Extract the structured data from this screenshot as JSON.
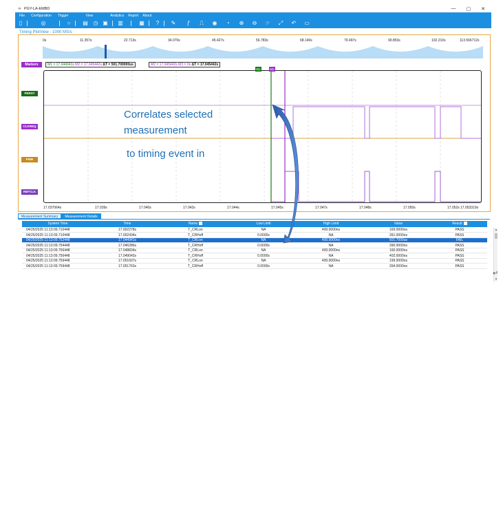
{
  "app": {
    "title": "PGY-LA-EMBD",
    "window_controls": [
      "—",
      "▢",
      "✕"
    ]
  },
  "menu": [
    "File",
    "Configuration",
    "Trigger",
    "View",
    "Analytics",
    "Report",
    "About"
  ],
  "panel_title": "Timing PlotView - 1000 MS/s",
  "overview_ticks": [
    "0s",
    "11.357s",
    "22.713s",
    "34.070s",
    "45.427s",
    "56.783s",
    "68.140s",
    "79.497s",
    "90.853s",
    "102.210s",
    "113.566712s"
  ],
  "markers": {
    "label": "Markers",
    "box1": {
      "m1": "M1 = 17.044941s",
      "m2": "M2 = 17.045442s",
      "delta": "ΔT = 501.700000us"
    },
    "box2": {
      "m2": "M2 = 17.045442s",
      "m3": "M3 = 0s",
      "delta": "ΔT = 17.045442s"
    },
    "m1_tag": "M1",
    "m2_tag": "M2"
  },
  "signals": [
    {
      "name": "PERST",
      "color": "#1a6b1a"
    },
    {
      "name": "CLKREQ",
      "color": "#9b2fc8"
    },
    {
      "name": "PWR",
      "color": "#c98a1a"
    },
    {
      "name": "REFCLK",
      "color": "#7b3fb8"
    }
  ],
  "time_axis": [
    "17.037064s",
    "17.039s",
    "17.040s",
    "17.042s",
    "17.044s",
    "17.045s",
    "17.047s",
    "17.048s",
    "17.050s",
    "17.052s",
    "17.053319s"
  ],
  "annotation": {
    "line1": "Correlates selected",
    "line2": "measurement",
    "line3": "to timing event in"
  },
  "tabs": [
    "Measurement Summary",
    "Measurement Details"
  ],
  "table": {
    "columns": [
      "System Time",
      "Time",
      "Name",
      "Low Limit",
      "High Limit",
      "Value",
      "Result"
    ],
    "rows": [
      [
        "04/25/2025 11:13:09.710448",
        "17.002278s",
        "T_CRLon",
        "NA",
        "400.0000ns",
        "169.0000ns",
        "PASS"
      ],
      [
        "04/25/2025 11:13:09.710448",
        "17.002434s",
        "T_CRHoff",
        "0.0000s",
        "NA",
        "391.0000ns",
        "PASS"
      ],
      [
        "04/25/2025 11:13:09.752448",
        "17.044941s",
        "T_CRLon",
        "NA",
        "400.0000ns",
        "501.7000us",
        "FAIL"
      ],
      [
        "04/25/2025 11:13:09.754448",
        "17.046286s",
        "T_CRHoff",
        "0.0000s",
        "NA",
        "390.0000ns",
        "PASS"
      ],
      [
        "04/25/2025 11:13:09.756448",
        "17.048834s",
        "T_CRLon",
        "NA",
        "400.0000ns",
        "160.0000ns",
        "PASS"
      ],
      [
        "04/25/2025 11:13:09.756448",
        "17.049043s",
        "T_CRHoff",
        "0.0000s",
        "NA",
        "402.0000ns",
        "PASS"
      ],
      [
        "04/25/2025 11:13:09.759448",
        "17.051607s",
        "T_CRLon",
        "NA",
        "400.0000ns",
        "199.0000ns",
        "PASS"
      ],
      [
        "04/25/2025 11:13:09.759448",
        "17.051763s",
        "T_CRHoff",
        "0.0000s",
        "NA",
        "394.0000ns",
        "PASS"
      ]
    ],
    "selected_row": 2
  },
  "colors": {
    "accent": "#1d8fe0",
    "panel_border": "#e7a742",
    "selected_row": "#1a6fd0",
    "arrow": "#2f66b3"
  }
}
